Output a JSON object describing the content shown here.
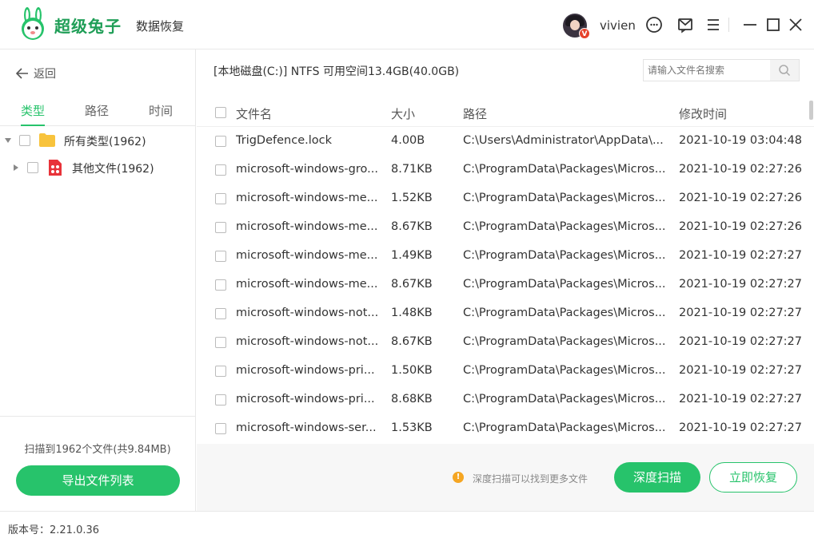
{
  "app": {
    "name": "超级兔子",
    "subtitle": "数据恢复",
    "username": "vivien",
    "vip_badge": "V",
    "brand_color": "#27c36b"
  },
  "left": {
    "back_label": "返回",
    "tabs": [
      "类型",
      "路径",
      "时间"
    ],
    "active_tab": "类型",
    "tree": [
      {
        "label": "所有类型(1962)",
        "icon": "folder-icon"
      },
      {
        "label": "其他文件(1962)",
        "icon": "other-file-icon"
      }
    ],
    "scan_info": "扫描到1962个文件(共9.84MB)",
    "export_label": "导出文件列表"
  },
  "main": {
    "disk_info": "[本地磁盘(C:)] NTFS 可用空间13.4GB(40.0GB)",
    "search_placeholder": "请输入文件名搜索",
    "columns": [
      "文件名",
      "大小",
      "路径",
      "修改时间"
    ],
    "rows": [
      {
        "name": "TrigDefence.lock",
        "size": "4.00B",
        "path": "C:\\Users\\Administrator\\AppData\\...",
        "time": "2021-10-19 03:04:48"
      },
      {
        "name": "microsoft-windows-gro...",
        "size": "8.71KB",
        "path": "C:\\ProgramData\\Packages\\Micros...",
        "time": "2021-10-19 02:27:26"
      },
      {
        "name": "microsoft-windows-me...",
        "size": "1.52KB",
        "path": "C:\\ProgramData\\Packages\\Micros...",
        "time": "2021-10-19 02:27:26"
      },
      {
        "name": "microsoft-windows-me...",
        "size": "8.67KB",
        "path": "C:\\ProgramData\\Packages\\Micros...",
        "time": "2021-10-19 02:27:26"
      },
      {
        "name": "microsoft-windows-me...",
        "size": "1.49KB",
        "path": "C:\\ProgramData\\Packages\\Micros...",
        "time": "2021-10-19 02:27:27"
      },
      {
        "name": "microsoft-windows-me...",
        "size": "8.67KB",
        "path": "C:\\ProgramData\\Packages\\Micros...",
        "time": "2021-10-19 02:27:27"
      },
      {
        "name": "microsoft-windows-not...",
        "size": "1.48KB",
        "path": "C:\\ProgramData\\Packages\\Micros...",
        "time": "2021-10-19 02:27:27"
      },
      {
        "name": "microsoft-windows-not...",
        "size": "8.67KB",
        "path": "C:\\ProgramData\\Packages\\Micros...",
        "time": "2021-10-19 02:27:27"
      },
      {
        "name": "microsoft-windows-pri...",
        "size": "1.50KB",
        "path": "C:\\ProgramData\\Packages\\Micros...",
        "time": "2021-10-19 02:27:27"
      },
      {
        "name": "microsoft-windows-pri...",
        "size": "8.68KB",
        "path": "C:\\ProgramData\\Packages\\Micros...",
        "time": "2021-10-19 02:27:27"
      },
      {
        "name": "microsoft-windows-ser...",
        "size": "1.53KB",
        "path": "C:\\ProgramData\\Packages\\Micros...",
        "time": "2021-10-19 02:27:27"
      }
    ],
    "tip_icon": "!",
    "tip": "深度扫描可以找到更多文件",
    "deep_scan_label": "深度扫描",
    "recover_label": "立即恢复"
  },
  "footer": {
    "version": "版本号：2.21.0.36"
  }
}
